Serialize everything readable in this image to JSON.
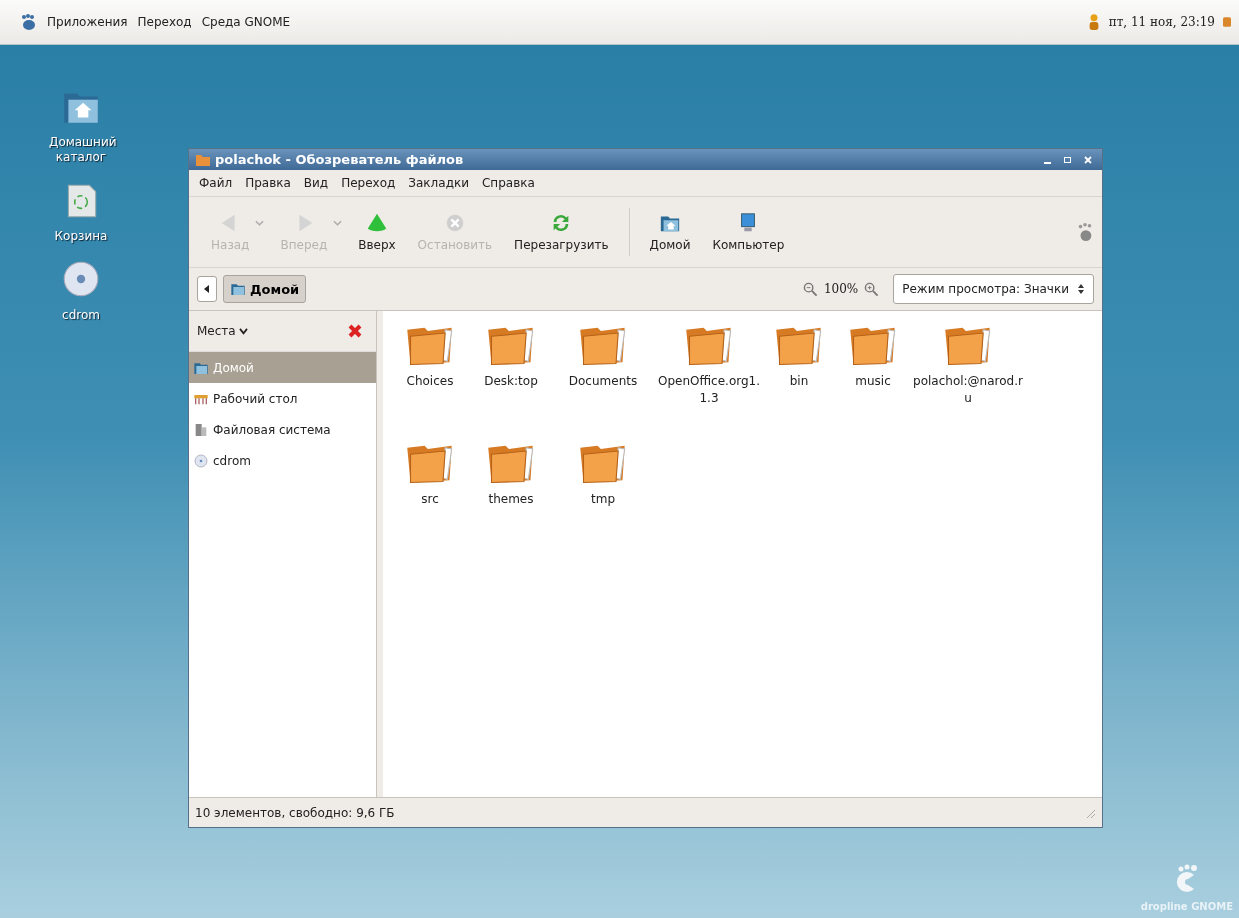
{
  "top_panel": {
    "menus": [
      "Приложения",
      "Переход",
      "Среда GNOME"
    ],
    "clock": "пт, 11 ноя, 23:19"
  },
  "desktop_icons": [
    {
      "kind": "home",
      "label": "Домашний каталог"
    },
    {
      "kind": "trash",
      "label": "Корзина"
    },
    {
      "kind": "cdrom",
      "label": "cdrom"
    }
  ],
  "window": {
    "title": "polachok - Обозреватель файлов",
    "menu": [
      "Файл",
      "Правка",
      "Вид",
      "Переход",
      "Закладки",
      "Справка"
    ],
    "toolbar": [
      {
        "kind": "back",
        "label": "Назад",
        "disabled": true
      },
      {
        "kind": "forward",
        "label": "Вперед",
        "disabled": true
      },
      {
        "kind": "up",
        "label": "Вверх",
        "disabled": false
      },
      {
        "kind": "stop",
        "label": "Остановить",
        "disabled": true
      },
      {
        "kind": "reload",
        "label": "Перезагрузить",
        "disabled": false
      },
      {
        "kind": "home",
        "label": "Домой",
        "disabled": false
      },
      {
        "kind": "computer",
        "label": "Компьютер",
        "disabled": false
      }
    ],
    "path": [
      {
        "label": "Домой",
        "selected": true
      }
    ],
    "zoom": "100%",
    "view_mode": "Режим просмотра: Значки",
    "sidebar": {
      "title": "Места",
      "items": [
        {
          "kind": "home",
          "label": "Домой",
          "selected": true
        },
        {
          "kind": "desktop",
          "label": "Рабочий стол",
          "selected": false
        },
        {
          "kind": "filesystem",
          "label": "Файловая система",
          "selected": false
        },
        {
          "kind": "cdrom",
          "label": "cdrom",
          "selected": false
        }
      ]
    },
    "files": [
      "Choices",
      "Desk:top",
      "Documents",
      "OpenOffice.org1.1.3",
      "bin",
      "music",
      "polachol:@narod.ru",
      "src",
      "themes",
      "tmp"
    ],
    "status_bar": "10 элементов, свободно: 9,6 ГБ"
  },
  "wallpaper_logo": "dropline GNOME"
}
